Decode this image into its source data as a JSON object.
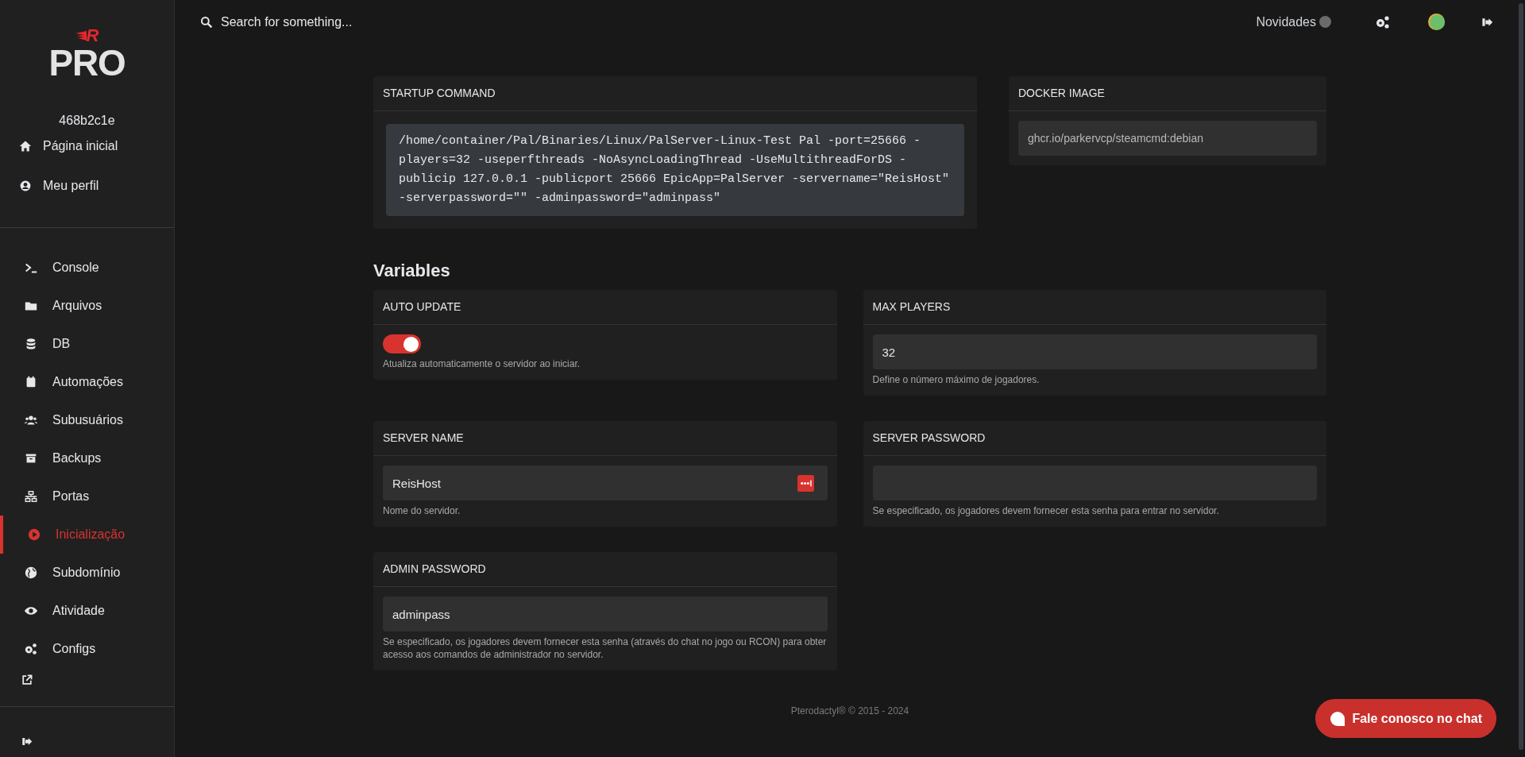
{
  "sidebar": {
    "logo": {
      "mark": "R",
      "text": "PRO"
    },
    "server_id": "468b2c1e",
    "top_items": [
      {
        "label": "Página inicial"
      },
      {
        "label": "Meu perfil"
      }
    ],
    "nav_items": [
      {
        "label": "Console",
        "selected": false
      },
      {
        "label": "Arquivos",
        "selected": false
      },
      {
        "label": "DB",
        "selected": false
      },
      {
        "label": "Automações",
        "selected": false
      },
      {
        "label": "Subusuários",
        "selected": false
      },
      {
        "label": "Backups",
        "selected": false
      },
      {
        "label": "Portas",
        "selected": false
      },
      {
        "label": "Inicialização",
        "selected": true
      },
      {
        "label": "Subdomínio",
        "selected": false
      },
      {
        "label": "Atividade",
        "selected": false
      },
      {
        "label": "Configs",
        "selected": false
      }
    ]
  },
  "top_bar": {
    "search": {
      "placeholder": "Search for something..."
    },
    "news": "Novidades"
  },
  "startup_command": {
    "title": "STARTUP COMMAND",
    "command": "/home/container/Pal/Binaries/Linux/PalServer-Linux-Test Pal -port=25666 -players=32 -useperfthreads -NoAsyncLoadingThread -UseMultithreadForDS -publicip 127.0.0.1 -publicport 25666 EpicApp=PalServer -servername=\"ReisHost\" -serverpassword=\"\" -adminpassword=\"adminpass\""
  },
  "docker_image": {
    "title": "DOCKER IMAGE",
    "value": "ghcr.io/parkervcp/steamcmd:debian"
  },
  "variables": {
    "title": "Variables",
    "items": [
      {
        "kind": "toggle",
        "title": "AUTO UPDATE",
        "on": true,
        "description": "Atualiza automaticamente o servidor ao iniciar."
      },
      {
        "kind": "text",
        "title": "MAX PLAYERS",
        "value": "32",
        "description": "Define o número máximo de jogadores.",
        "field_badge": false
      },
      {
        "kind": "text",
        "title": "SERVER NAME",
        "value": "ReisHost",
        "description": "Nome do servidor.",
        "field_badge": true
      },
      {
        "kind": "text",
        "title": "SERVER PASSWORD",
        "description": "Se especificado, os jogadores devem fornecer esta senha para entrar no servidor.",
        "field_badge": false
      },
      {
        "kind": "text",
        "title": "ADMIN PASSWORD",
        "value": "adminpass",
        "description": "Se especificado, os jogadores devem fornecer esta senha (através do chat no jogo ou RCON) para obter acesso aos comandos de administrador no servidor.",
        "field_badge": false
      }
    ]
  },
  "footer": "Pterodactyl® © 2015 - 2024",
  "chat_button": "Fale conosco no chat"
}
